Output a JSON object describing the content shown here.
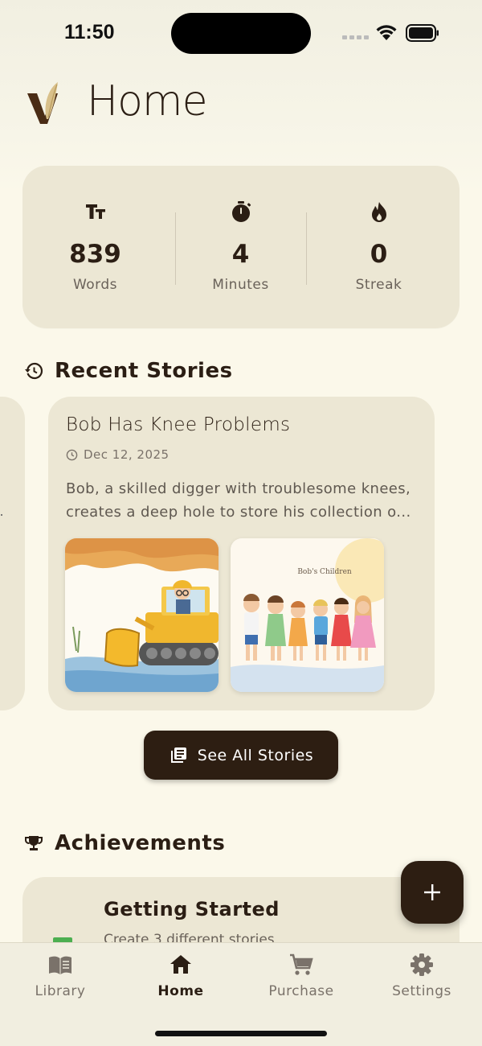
{
  "status_bar": {
    "time": "11:50"
  },
  "header": {
    "title": "Home",
    "logo_icon": "v-feather-logo"
  },
  "stats": [
    {
      "icon": "text-size-icon",
      "value": "839",
      "label": "Words"
    },
    {
      "icon": "stopwatch-icon",
      "value": "4",
      "label": "Minutes"
    },
    {
      "icon": "flame-icon",
      "value": "0",
      "label": "Streak"
    }
  ],
  "recent_stories": {
    "title": "Recent Stories",
    "icon": "history-icon",
    "stories": [
      {
        "title": "Bob Has Knee Problems",
        "date": "Dec 12, 2025",
        "summary": "Bob, a skilled digger with troublesome knees, creates a deep hole to store his collection o...",
        "thumbnails": [
          {
            "kind": "bulldozer-illustration",
            "caption": ""
          },
          {
            "kind": "children-illustration",
            "caption": "Bob's Children"
          }
        ]
      }
    ],
    "see_all_label": "See All Stories"
  },
  "achievements": {
    "title": "Achievements",
    "icon": "trophy-icon",
    "items": [
      {
        "title": "Getting Started",
        "description": "Create 3 different stories"
      }
    ]
  },
  "fab": {
    "icon": "plus-icon"
  },
  "bottom_nav": [
    {
      "label": "Library",
      "icon": "book-icon",
      "active": false
    },
    {
      "label": "Home",
      "icon": "home-icon",
      "active": true
    },
    {
      "label": "Purchase",
      "icon": "cart-icon",
      "active": false
    },
    {
      "label": "Settings",
      "icon": "gear-icon",
      "active": false
    }
  ],
  "colors": {
    "accent": "#2d1e12",
    "card": "#ece7d4",
    "background": "#fbf8ea",
    "progress": "#4caf50"
  }
}
